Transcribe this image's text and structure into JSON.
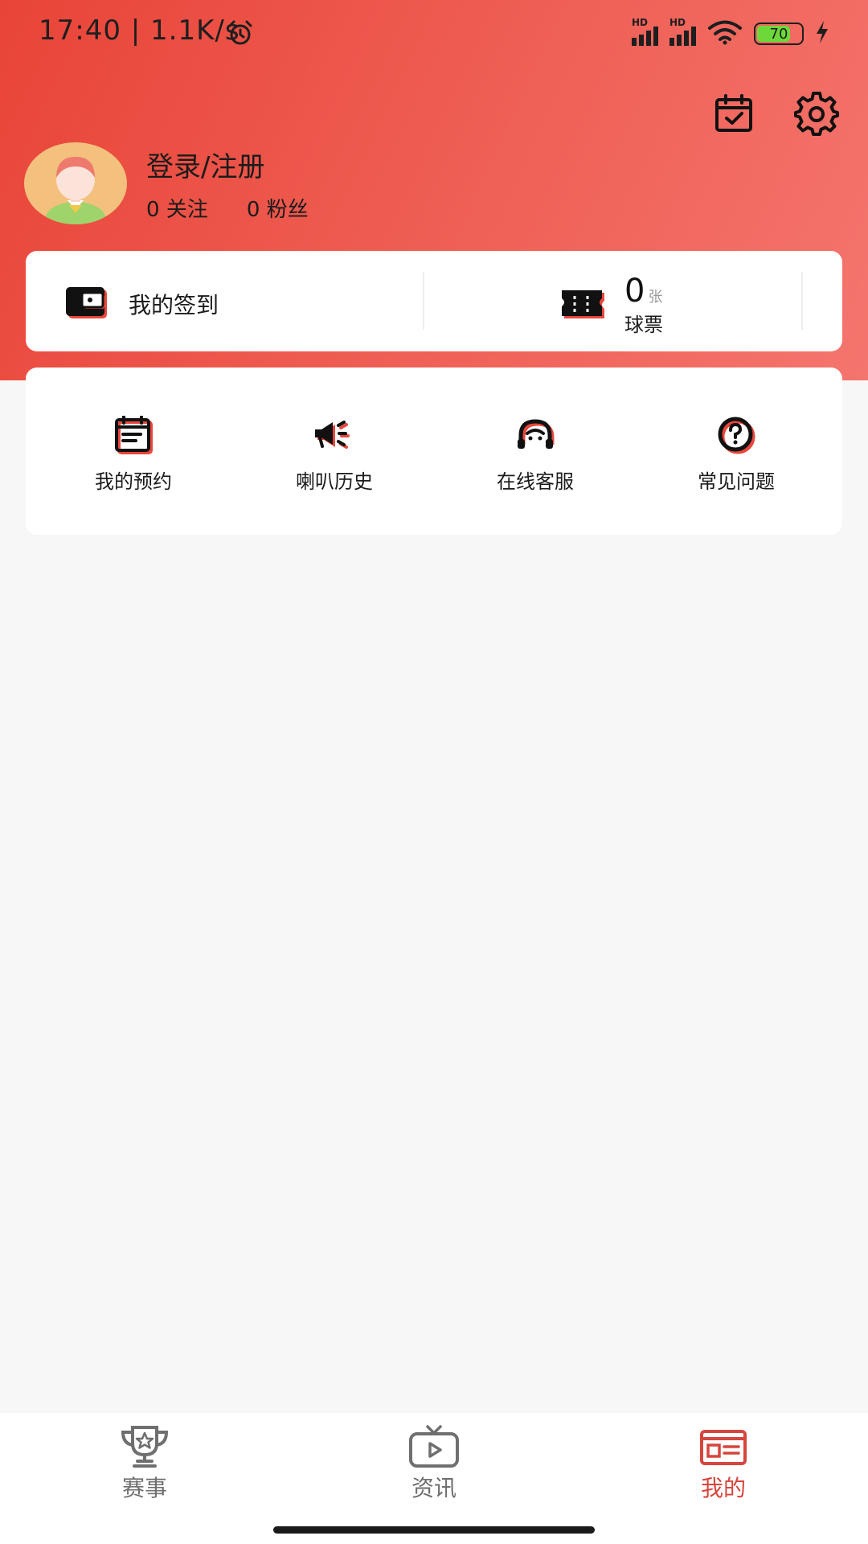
{
  "status_bar": {
    "time_speed": "17:40 | 1.1K/s",
    "alarm_icon": "alarm-clock-icon",
    "signal_label_1": "HD",
    "signal_label_2": "HD",
    "wifi_icon": "wifi-icon",
    "battery_level": "70",
    "charging_icon": "lightning-icon"
  },
  "header": {
    "calendar_icon": "calendar-check-icon",
    "settings_icon": "gear-icon",
    "login_text": "登录/注册",
    "following_count": "0",
    "following_label": "关注",
    "followers_count": "0",
    "followers_label": "粉丝"
  },
  "sign_card": {
    "checkin_label": "我的签到",
    "ticket_count": "0",
    "ticket_unit": "张",
    "ticket_label": "球票"
  },
  "services": [
    {
      "label": "我的预约",
      "icon": "calendar-list-icon"
    },
    {
      "label": "喇叭历史",
      "icon": "megaphone-icon"
    },
    {
      "label": "在线客服",
      "icon": "headset-icon"
    },
    {
      "label": "常见问题",
      "icon": "question-circle-icon"
    }
  ],
  "bottom_nav": {
    "items": [
      {
        "label": "赛事",
        "icon": "trophy-icon"
      },
      {
        "label": "资讯",
        "icon": "tv-play-icon"
      },
      {
        "label": "我的",
        "icon": "profile-card-icon"
      }
    ],
    "active_index": 2
  },
  "colors": {
    "header_gradient_start": "#e94438",
    "header_gradient_end": "#f4756e",
    "accent": "#d6463d",
    "icon_shadow": "#e8473c",
    "inactive_nav": "#6f6f6f"
  }
}
